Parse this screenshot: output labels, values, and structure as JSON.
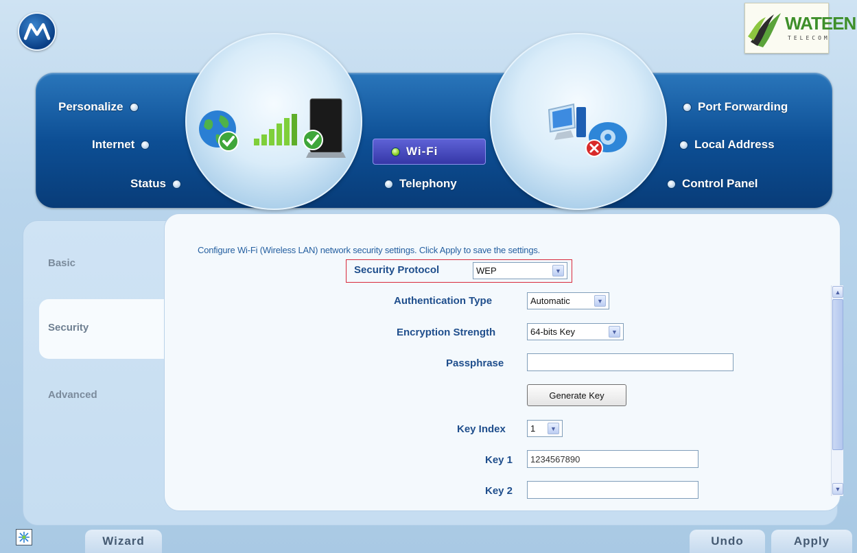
{
  "header": {
    "brand_logo_name": "WATEEN",
    "brand_logo_sub": "TELECOM"
  },
  "nav": {
    "left": [
      "Personalize",
      "Internet",
      "Status"
    ],
    "center": [
      "Wi-Fi",
      "Telephony"
    ],
    "right": [
      "Port Forwarding",
      "Local Address",
      "Control Panel"
    ],
    "active": "Wi-Fi"
  },
  "sidebar": {
    "tabs": [
      "Basic",
      "Security",
      "Advanced"
    ],
    "active": "Security"
  },
  "form": {
    "intro": "Configure Wi-Fi (Wireless LAN) network security settings. Click Apply to save the settings.",
    "security_protocol_label": "Security Protocol",
    "security_protocol_value": "WEP",
    "auth_type_label": "Authentication Type",
    "auth_type_value": "Automatic",
    "enc_strength_label": "Encryption Strength",
    "enc_strength_value": "64-bits Key",
    "passphrase_label": "Passphrase",
    "passphrase_value": "",
    "generate_key_label": "Generate Key",
    "key_index_label": "Key Index",
    "key_index_value": "1",
    "key1_label": "Key 1",
    "key1_value": "1234567890",
    "key2_label": "Key 2",
    "key2_value": ""
  },
  "footer": {
    "wizard_label": "Wizard",
    "undo_label": "Undo",
    "apply_label": "Apply"
  },
  "colors": {
    "nav_band": "#0d4f95",
    "label_blue": "#1f4e8c",
    "highlight_red": "#d8283a",
    "active_dot": "#8ed12a"
  }
}
